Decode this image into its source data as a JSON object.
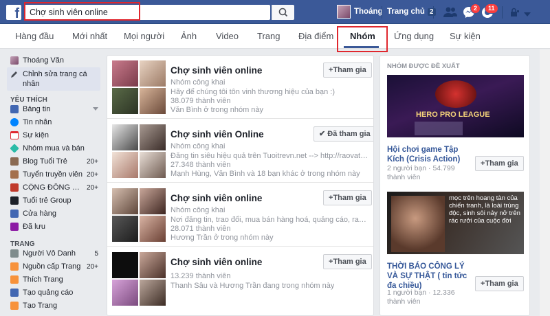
{
  "topbar": {
    "search_value": "Chợ sinh viên online",
    "user_name": "Thoáng",
    "home_label": "Trang chủ",
    "home_count": "2",
    "messages_badge": "2",
    "notifications_badge": "11"
  },
  "tabs": [
    {
      "label": "Hàng đầu"
    },
    {
      "label": "Mới nhất"
    },
    {
      "label": "Mọi người"
    },
    {
      "label": "Ảnh"
    },
    {
      "label": "Video"
    },
    {
      "label": "Trang"
    },
    {
      "label": "Địa điểm"
    },
    {
      "label": "Nhóm"
    },
    {
      "label": "Ứng dụng"
    },
    {
      "label": "Sự kiện"
    }
  ],
  "sidebar": {
    "profile_name": "Thoáng Văn",
    "edit_profile": "Chỉnh sửa trang cá nhân",
    "favorites_heading": "YÊU THÍCH",
    "favorites": [
      {
        "label": "Bảng tin",
        "count": ""
      },
      {
        "label": "Tin nhắn",
        "count": ""
      },
      {
        "label": "Sự kiện",
        "count": ""
      },
      {
        "label": "Nhóm mua và bán",
        "count": ""
      },
      {
        "label": "Blog Tuổi Trẻ",
        "count": "20+"
      },
      {
        "label": "Tuyển truyền viên",
        "count": "20+"
      },
      {
        "label": "CỘNG ĐỒNG TƯ ...",
        "count": "20+"
      },
      {
        "label": "Tuổi trẻ Group",
        "count": ""
      },
      {
        "label": "Cửa hàng",
        "count": ""
      },
      {
        "label": "Đã lưu",
        "count": ""
      }
    ],
    "pages_heading": "TRANG",
    "pages": [
      {
        "label": "Người Vô Danh",
        "count": "5"
      },
      {
        "label": "Nguồn cấp Trang",
        "count": "20+"
      },
      {
        "label": "Thích Trang",
        "count": ""
      },
      {
        "label": "Tạo quảng cáo",
        "count": ""
      },
      {
        "label": "Tạo Trang",
        "count": ""
      }
    ]
  },
  "groups": [
    {
      "title": "Chợ sinh viên online",
      "type": "Nhóm công khai",
      "description": "Hãy để chúng tôi tôn vinh thương hiệu của bạn :)",
      "members": "38.079 thành viên",
      "friends": "Văn Bình ở trong nhóm này",
      "button": "Tham gia"
    },
    {
      "title": "Chợ sinh viên Online",
      "type": "Nhóm công khai",
      "description": "Đăng tin siêu hiệu quả trên Tuoitrevn.net --> http://raovat.tuoitrevn...",
      "members": "27.348 thành viên",
      "friends": "Mạnh Hùng, Văn Bình và 18 bạn khác ở trong nhóm này",
      "button": "Đã tham gia"
    },
    {
      "title": "Chợ sinh viên online",
      "type": "Nhóm công khai",
      "description": "Nơi đăng tin, trao đổi, mua bán hàng hoá, quảng cáo, rao vặt tồn...",
      "members": "28.071 thành viên",
      "friends": "Hương Trần ở trong nhóm này",
      "button": "Tham gia"
    },
    {
      "title": "Chợ sinh viên online",
      "type": "",
      "description": "",
      "members": "13.239 thành viên",
      "friends": "Thanh Sâu và Hương Trần đang trong nhóm này",
      "button": "Tham gia"
    }
  ],
  "suggested": {
    "heading": "NHÓM ĐƯỢC ĐỀ XUẤT",
    "items": [
      {
        "title": "Hội chơi game Tập Kích (Crisis Action)",
        "meta": "2 người bạn · 54.799 thành viên",
        "button": "Tham gia"
      },
      {
        "title": "THỜI BÁO CÔNG LÝ VÀ SỰ THẬT ( tin tức đa chiều)",
        "meta": "1 người bạn · 12.336 thành viên",
        "button": "Tham gia"
      }
    ],
    "ad1_text": "HERO PRO LEAGUE",
    "ad2_text": "mọc trên hoang tàn của chiến tranh, là loài trùng độc, sinh sôi nảy nở trên rác rưởi của cuộc đời"
  },
  "colors": {
    "brand": "#3b5998",
    "highlight": "#e0272e",
    "link": "#365899"
  }
}
